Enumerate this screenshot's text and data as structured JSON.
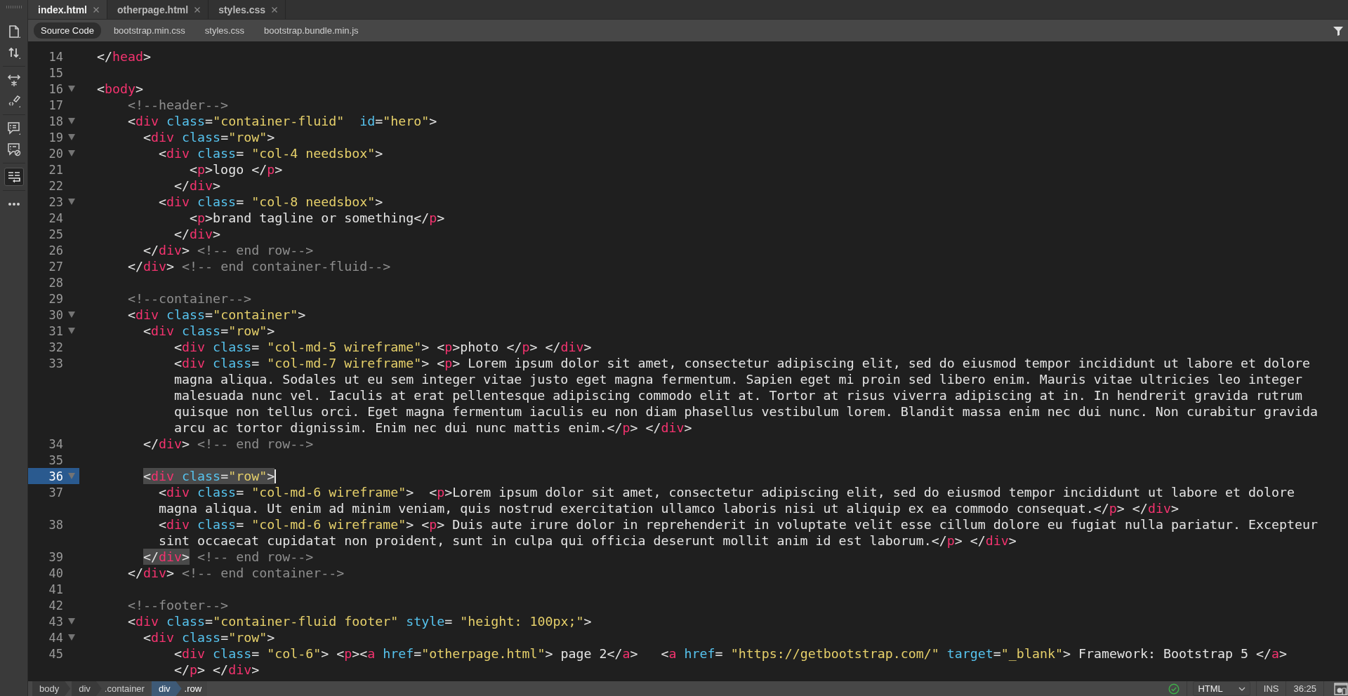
{
  "tabs": [
    {
      "label": "index.html",
      "selected": true
    },
    {
      "label": "otherpage.html",
      "selected": false
    },
    {
      "label": "styles.css",
      "selected": false
    }
  ],
  "related_files": [
    {
      "label": "Source Code",
      "selected": true
    },
    {
      "label": "bootstrap.min.css",
      "selected": false
    },
    {
      "label": "styles.css",
      "selected": false
    },
    {
      "label": "bootstrap.bundle.min.js",
      "selected": false
    }
  ],
  "sidebar_tools": [
    [
      {
        "kind": "file",
        "selected": false
      },
      {
        "kind": "sort",
        "selected": false
      }
    ],
    [
      {
        "kind": "expand",
        "selected": false
      },
      {
        "kind": "hint",
        "selected": false
      }
    ],
    [
      {
        "kind": "comment",
        "selected": false
      },
      {
        "kind": "uncomment",
        "selected": false
      }
    ],
    [
      {
        "kind": "wrap",
        "selected": true
      }
    ],
    [
      {
        "kind": "more",
        "selected": false
      }
    ]
  ],
  "code": {
    "lines": [
      {
        "number": "14",
        "fold": false,
        "current": false,
        "segments": [
          {
            "tokens": [
              {
                "kind": "plain",
                "text": "</"
              },
              {
                "kind": "tag",
                "text": "head"
              },
              {
                "kind": "plain",
                "text": ">"
              }
            ]
          }
        ]
      },
      {
        "number": "15",
        "fold": false,
        "current": false
      },
      {
        "number": "16",
        "fold": true,
        "current": false,
        "segments": [
          {
            "tokens": [
              {
                "kind": "plain",
                "text": "<"
              },
              {
                "kind": "tag",
                "text": "body"
              },
              {
                "kind": "plain",
                "text": ">"
              }
            ]
          }
        ]
      },
      {
        "number": "17",
        "fold": false,
        "current": false,
        "segments": [
          {
            "tokens": [
              {
                "kind": "comment",
                "text": "    <!--header-->"
              }
            ]
          }
        ]
      },
      {
        "number": "18",
        "fold": true,
        "current": false,
        "segments": [
          {
            "tokens": [
              {
                "kind": "plain",
                "text": "    <"
              },
              {
                "kind": "tag",
                "text": "div"
              },
              {
                "kind": "attr",
                "text": " class"
              },
              {
                "kind": "plain",
                "text": "="
              },
              {
                "kind": "string",
                "text": "\"container-fluid\""
              },
              {
                "kind": "attr",
                "text": "  id"
              },
              {
                "kind": "plain",
                "text": "="
              },
              {
                "kind": "string",
                "text": "\"hero\""
              },
              {
                "kind": "plain",
                "text": ">"
              }
            ]
          }
        ]
      },
      {
        "number": "19",
        "fold": true,
        "current": false,
        "segments": [
          {
            "tokens": [
              {
                "kind": "plain",
                "text": "      <"
              },
              {
                "kind": "tag",
                "text": "div"
              },
              {
                "kind": "attr",
                "text": " class"
              },
              {
                "kind": "plain",
                "text": "="
              },
              {
                "kind": "string",
                "text": "\"row\""
              },
              {
                "kind": "plain",
                "text": ">"
              }
            ]
          }
        ]
      },
      {
        "number": "20",
        "fold": true,
        "current": false,
        "segments": [
          {
            "tokens": [
              {
                "kind": "plain",
                "text": "        <"
              },
              {
                "kind": "tag",
                "text": "div"
              },
              {
                "kind": "attr",
                "text": " class"
              },
              {
                "kind": "plain",
                "text": "= "
              },
              {
                "kind": "string",
                "text": "\"col-4 needsbox\""
              },
              {
                "kind": "plain",
                "text": ">"
              }
            ]
          }
        ]
      },
      {
        "number": "21",
        "fold": false,
        "current": false,
        "segments": [
          {
            "tokens": [
              {
                "kind": "plain",
                "text": "            <"
              },
              {
                "kind": "tag",
                "text": "p"
              },
              {
                "kind": "plain",
                "text": ">logo </"
              },
              {
                "kind": "tag",
                "text": "p"
              },
              {
                "kind": "plain",
                "text": ">"
              }
            ]
          }
        ]
      },
      {
        "number": "22",
        "fold": false,
        "current": false,
        "segments": [
          {
            "tokens": [
              {
                "kind": "plain",
                "text": "          </"
              },
              {
                "kind": "tag",
                "text": "div"
              },
              {
                "kind": "plain",
                "text": ">"
              }
            ]
          }
        ]
      },
      {
        "number": "23",
        "fold": true,
        "current": false,
        "segments": [
          {
            "tokens": [
              {
                "kind": "plain",
                "text": "        <"
              },
              {
                "kind": "tag",
                "text": "div"
              },
              {
                "kind": "attr",
                "text": " class"
              },
              {
                "kind": "plain",
                "text": "= "
              },
              {
                "kind": "string",
                "text": "\"col-8 needsbox\""
              },
              {
                "kind": "plain",
                "text": ">"
              }
            ]
          }
        ]
      },
      {
        "number": "24",
        "fold": false,
        "current": false,
        "segments": [
          {
            "tokens": [
              {
                "kind": "plain",
                "text": "            <"
              },
              {
                "kind": "tag",
                "text": "p"
              },
              {
                "kind": "plain",
                "text": ">brand tagline or something</"
              },
              {
                "kind": "tag",
                "text": "p"
              },
              {
                "kind": "plain",
                "text": ">"
              }
            ]
          }
        ]
      },
      {
        "number": "25",
        "fold": false,
        "current": false,
        "segments": [
          {
            "tokens": [
              {
                "kind": "plain",
                "text": "          </"
              },
              {
                "kind": "tag",
                "text": "div"
              },
              {
                "kind": "plain",
                "text": ">"
              }
            ]
          }
        ]
      },
      {
        "number": "26",
        "fold": false,
        "current": false,
        "segments": [
          {
            "tokens": [
              {
                "kind": "plain",
                "text": "      </"
              },
              {
                "kind": "tag",
                "text": "div"
              },
              {
                "kind": "plain",
                "text": ">"
              },
              {
                "kind": "comment",
                "text": " <!-- end row-->"
              }
            ]
          }
        ]
      },
      {
        "number": "27",
        "fold": false,
        "current": false,
        "segments": [
          {
            "tokens": [
              {
                "kind": "plain",
                "text": "    </"
              },
              {
                "kind": "tag",
                "text": "div"
              },
              {
                "kind": "plain",
                "text": ">"
              },
              {
                "kind": "comment",
                "text": " <!-- end container-fluid-->"
              }
            ]
          }
        ]
      },
      {
        "number": "28",
        "fold": false,
        "current": false
      },
      {
        "number": "29",
        "fold": false,
        "current": false,
        "segments": [
          {
            "tokens": [
              {
                "kind": "comment",
                "text": "    <!--container-->"
              }
            ]
          }
        ]
      },
      {
        "number": "30",
        "fold": true,
        "current": false,
        "segments": [
          {
            "tokens": [
              {
                "kind": "plain",
                "text": "    <"
              },
              {
                "kind": "tag",
                "text": "div"
              },
              {
                "kind": "attr",
                "text": " class"
              },
              {
                "kind": "plain",
                "text": "="
              },
              {
                "kind": "string",
                "text": "\"container\""
              },
              {
                "kind": "plain",
                "text": ">"
              }
            ]
          }
        ]
      },
      {
        "number": "31",
        "fold": true,
        "current": false,
        "segments": [
          {
            "tokens": [
              {
                "kind": "plain",
                "text": "      <"
              },
              {
                "kind": "tag",
                "text": "div"
              },
              {
                "kind": "attr",
                "text": " class"
              },
              {
                "kind": "plain",
                "text": "="
              },
              {
                "kind": "string",
                "text": "\"row\""
              },
              {
                "kind": "plain",
                "text": ">"
              }
            ]
          }
        ]
      },
      {
        "number": "32",
        "fold": false,
        "current": false,
        "segments": [
          {
            "tokens": [
              {
                "kind": "plain",
                "text": "          <"
              },
              {
                "kind": "tag",
                "text": "div"
              },
              {
                "kind": "attr",
                "text": " class"
              },
              {
                "kind": "plain",
                "text": "= "
              },
              {
                "kind": "string",
                "text": "\"col-md-5 wireframe\""
              },
              {
                "kind": "plain",
                "text": "> <"
              },
              {
                "kind": "tag",
                "text": "p"
              },
              {
                "kind": "plain",
                "text": ">photo </"
              },
              {
                "kind": "tag",
                "text": "p"
              },
              {
                "kind": "plain",
                "text": "> </"
              },
              {
                "kind": "tag",
                "text": "div"
              },
              {
                "kind": "plain",
                "text": ">"
              }
            ]
          }
        ]
      },
      {
        "number": "33",
        "fold": false,
        "current": false,
        "segments": [
          {
            "tokens": [
              {
                "kind": "plain",
                "text": "          <"
              },
              {
                "kind": "tag",
                "text": "div"
              },
              {
                "kind": "attr",
                "text": " class"
              },
              {
                "kind": "plain",
                "text": "= "
              },
              {
                "kind": "string",
                "text": "\"col-md-7 wireframe\""
              },
              {
                "kind": "plain",
                "text": "> <"
              },
              {
                "kind": "tag",
                "text": "p"
              },
              {
                "kind": "plain",
                "text": "> Lorem ipsum dolor sit amet, consectetur adipiscing elit, sed do eiusmod tempor incididunt ut labore et dolore"
              }
            ]
          },
          {
            "tokens": [
              {
                "kind": "plain",
                "text": "          magna aliqua. Sodales ut eu sem integer vitae justo eget magna fermentum. Sapien eget mi proin sed libero enim. Mauris vitae ultricies leo integer"
              }
            ]
          },
          {
            "tokens": [
              {
                "kind": "plain",
                "text": "          malesuada nunc vel. Iaculis at erat pellentesque adipiscing commodo elit at. Tortor at risus viverra adipiscing at in. In hendrerit gravida rutrum"
              }
            ]
          },
          {
            "tokens": [
              {
                "kind": "plain",
                "text": "          quisque non tellus orci. Eget magna fermentum iaculis eu non diam phasellus vestibulum lorem. Blandit massa enim nec dui nunc. Non curabitur gravida"
              }
            ]
          },
          {
            "tokens": [
              {
                "kind": "plain",
                "text": "          arcu ac tortor dignissim. Enim nec dui nunc mattis enim.</"
              },
              {
                "kind": "tag",
                "text": "p"
              },
              {
                "kind": "plain",
                "text": "> </"
              },
              {
                "kind": "tag",
                "text": "div"
              },
              {
                "kind": "plain",
                "text": ">"
              }
            ]
          }
        ]
      },
      {
        "number": "34",
        "fold": false,
        "current": false,
        "segments": [
          {
            "tokens": [
              {
                "kind": "plain",
                "text": "      </"
              },
              {
                "kind": "tag",
                "text": "div"
              },
              {
                "kind": "plain",
                "text": ">"
              },
              {
                "kind": "comment",
                "text": " <!-- end row-->"
              }
            ]
          }
        ]
      },
      {
        "number": "35",
        "fold": false,
        "current": false
      },
      {
        "number": "36",
        "fold": true,
        "current": true,
        "segments": [
          {
            "tokens": [
              {
                "kind": "match",
                "tokens": [
                  {
                    "kind": "plain",
                    "text": "      <"
                  },
                  {
                    "kind": "tag",
                    "text": "div"
                  },
                  {
                    "kind": "attr",
                    "text": " class"
                  },
                  {
                    "kind": "plain",
                    "text": "="
                  },
                  {
                    "kind": "string",
                    "text": "\"row\""
                  },
                  {
                    "kind": "plain",
                    "text": ">"
                  }
                ]
              }
            ]
          }
        ]
      },
      {
        "number": "37",
        "fold": false,
        "current": false,
        "segments": [
          {
            "tokens": [
              {
                "kind": "plain",
                "text": "        <"
              },
              {
                "kind": "tag",
                "text": "div"
              },
              {
                "kind": "attr",
                "text": " class"
              },
              {
                "kind": "plain",
                "text": "= "
              },
              {
                "kind": "string",
                "text": "\"col-md-6 wireframe\""
              },
              {
                "kind": "plain",
                "text": ">  <"
              },
              {
                "kind": "tag",
                "text": "p"
              },
              {
                "kind": "plain",
                "text": ">Lorem ipsum dolor sit amet, consectetur adipiscing elit, sed do eiusmod tempor incididunt ut labore et dolore"
              }
            ]
          },
          {
            "tokens": [
              {
                "kind": "plain",
                "text": "        magna aliqua. Ut enim ad minim veniam, quis nostrud exercitation ullamco laboris nisi ut aliquip ex ea commodo consequat.</"
              },
              {
                "kind": "tag",
                "text": "p"
              },
              {
                "kind": "plain",
                "text": "> </"
              },
              {
                "kind": "tag",
                "text": "div"
              },
              {
                "kind": "plain",
                "text": ">"
              }
            ]
          }
        ]
      },
      {
        "number": "38",
        "fold": false,
        "current": false,
        "segments": [
          {
            "tokens": [
              {
                "kind": "plain",
                "text": "        <"
              },
              {
                "kind": "tag",
                "text": "div"
              },
              {
                "kind": "attr",
                "text": " class"
              },
              {
                "kind": "plain",
                "text": "= "
              },
              {
                "kind": "string",
                "text": "\"col-md-6 wireframe\""
              },
              {
                "kind": "plain",
                "text": "> <"
              },
              {
                "kind": "tag",
                "text": "p"
              },
              {
                "kind": "plain",
                "text": "> Duis aute irure dolor in reprehenderit in voluptate velit esse cillum dolore eu fugiat nulla pariatur. Excepteur"
              }
            ]
          },
          {
            "tokens": [
              {
                "kind": "plain",
                "text": "        sint occaecat cupidatat non proident, sunt in culpa qui officia deserunt mollit anim id est laborum.</"
              },
              {
                "kind": "tag",
                "text": "p"
              },
              {
                "kind": "plain",
                "text": "> </"
              },
              {
                "kind": "tag",
                "text": "div"
              },
              {
                "kind": "plain",
                "text": ">"
              }
            ]
          }
        ]
      },
      {
        "number": "39",
        "fold": false,
        "current": false,
        "segments": [
          {
            "tokens": [
              {
                "kind": "match",
                "tokens": [
                  {
                    "kind": "plain",
                    "text": "      </"
                  },
                  {
                    "kind": "tag",
                    "text": "div"
                  },
                  {
                    "kind": "plain",
                    "text": ">"
                  }
                ]
              },
              {
                "kind": "comment",
                "text": " <!-- end row-->"
              }
            ]
          }
        ]
      },
      {
        "number": "40",
        "fold": false,
        "current": false,
        "segments": [
          {
            "tokens": [
              {
                "kind": "plain",
                "text": "    </"
              },
              {
                "kind": "tag",
                "text": "div"
              },
              {
                "kind": "plain",
                "text": ">"
              },
              {
                "kind": "comment",
                "text": " <!-- end container-->"
              }
            ]
          }
        ]
      },
      {
        "number": "41",
        "fold": false,
        "current": false
      },
      {
        "number": "42",
        "fold": false,
        "current": false,
        "segments": [
          {
            "tokens": [
              {
                "kind": "comment",
                "text": "    <!--footer-->"
              }
            ]
          }
        ]
      },
      {
        "number": "43",
        "fold": true,
        "current": false,
        "segments": [
          {
            "tokens": [
              {
                "kind": "plain",
                "text": "    <"
              },
              {
                "kind": "tag",
                "text": "div"
              },
              {
                "kind": "attr",
                "text": " class"
              },
              {
                "kind": "plain",
                "text": "="
              },
              {
                "kind": "string",
                "text": "\"container-fluid footer\""
              },
              {
                "kind": "attr",
                "text": " style"
              },
              {
                "kind": "plain",
                "text": "= "
              },
              {
                "kind": "string",
                "text": "\"height: 100px;\""
              },
              {
                "kind": "plain",
                "text": ">"
              }
            ]
          }
        ]
      },
      {
        "number": "44",
        "fold": true,
        "current": false,
        "segments": [
          {
            "tokens": [
              {
                "kind": "plain",
                "text": "      <"
              },
              {
                "kind": "tag",
                "text": "div"
              },
              {
                "kind": "attr",
                "text": " class"
              },
              {
                "kind": "plain",
                "text": "="
              },
              {
                "kind": "string",
                "text": "\"row\""
              },
              {
                "kind": "plain",
                "text": ">"
              }
            ]
          }
        ]
      },
      {
        "number": "45",
        "fold": false,
        "current": false,
        "segments": [
          {
            "tokens": [
              {
                "kind": "plain",
                "text": "          <"
              },
              {
                "kind": "tag",
                "text": "div"
              },
              {
                "kind": "attr",
                "text": " class"
              },
              {
                "kind": "plain",
                "text": "= "
              },
              {
                "kind": "string",
                "text": "\"col-6\""
              },
              {
                "kind": "plain",
                "text": "> <"
              },
              {
                "kind": "tag",
                "text": "p"
              },
              {
                "kind": "plain",
                "text": "><"
              },
              {
                "kind": "tag",
                "text": "a"
              },
              {
                "kind": "attr",
                "text": " href"
              },
              {
                "kind": "plain",
                "text": "="
              },
              {
                "kind": "string",
                "text": "\"otherpage.html\""
              },
              {
                "kind": "plain",
                "text": "> page 2</"
              },
              {
                "kind": "tag",
                "text": "a"
              },
              {
                "kind": "plain",
                "text": ">   <"
              },
              {
                "kind": "tag",
                "text": "a"
              },
              {
                "kind": "attr",
                "text": " href"
              },
              {
                "kind": "plain",
                "text": "= "
              },
              {
                "kind": "string",
                "text": "\"https://getbootstrap.com/\""
              },
              {
                "kind": "attr",
                "text": " target"
              },
              {
                "kind": "plain",
                "text": "="
              },
              {
                "kind": "string",
                "text": "\"_blank\""
              },
              {
                "kind": "plain",
                "text": "> Framework: Bootstrap 5 </"
              },
              {
                "kind": "tag",
                "text": "a"
              },
              {
                "kind": "plain",
                "text": ">"
              }
            ]
          },
          {
            "tokens": [
              {
                "kind": "plain",
                "text": "          </"
              },
              {
                "kind": "tag",
                "text": "p"
              },
              {
                "kind": "plain",
                "text": "> </"
              },
              {
                "kind": "tag",
                "text": "div"
              },
              {
                "kind": "plain",
                "text": ">"
              }
            ]
          }
        ]
      }
    ]
  },
  "status_bar": {
    "breadcrumbs": [
      {
        "tag": "body",
        "selected": false
      },
      {
        "tag": "div",
        "class_name": ".container",
        "selected": false
      },
      {
        "tag": "div",
        "class_name": ".row",
        "selected": true
      }
    ],
    "valid": true,
    "language": "HTML",
    "mode": "INS",
    "position": "36:25"
  }
}
